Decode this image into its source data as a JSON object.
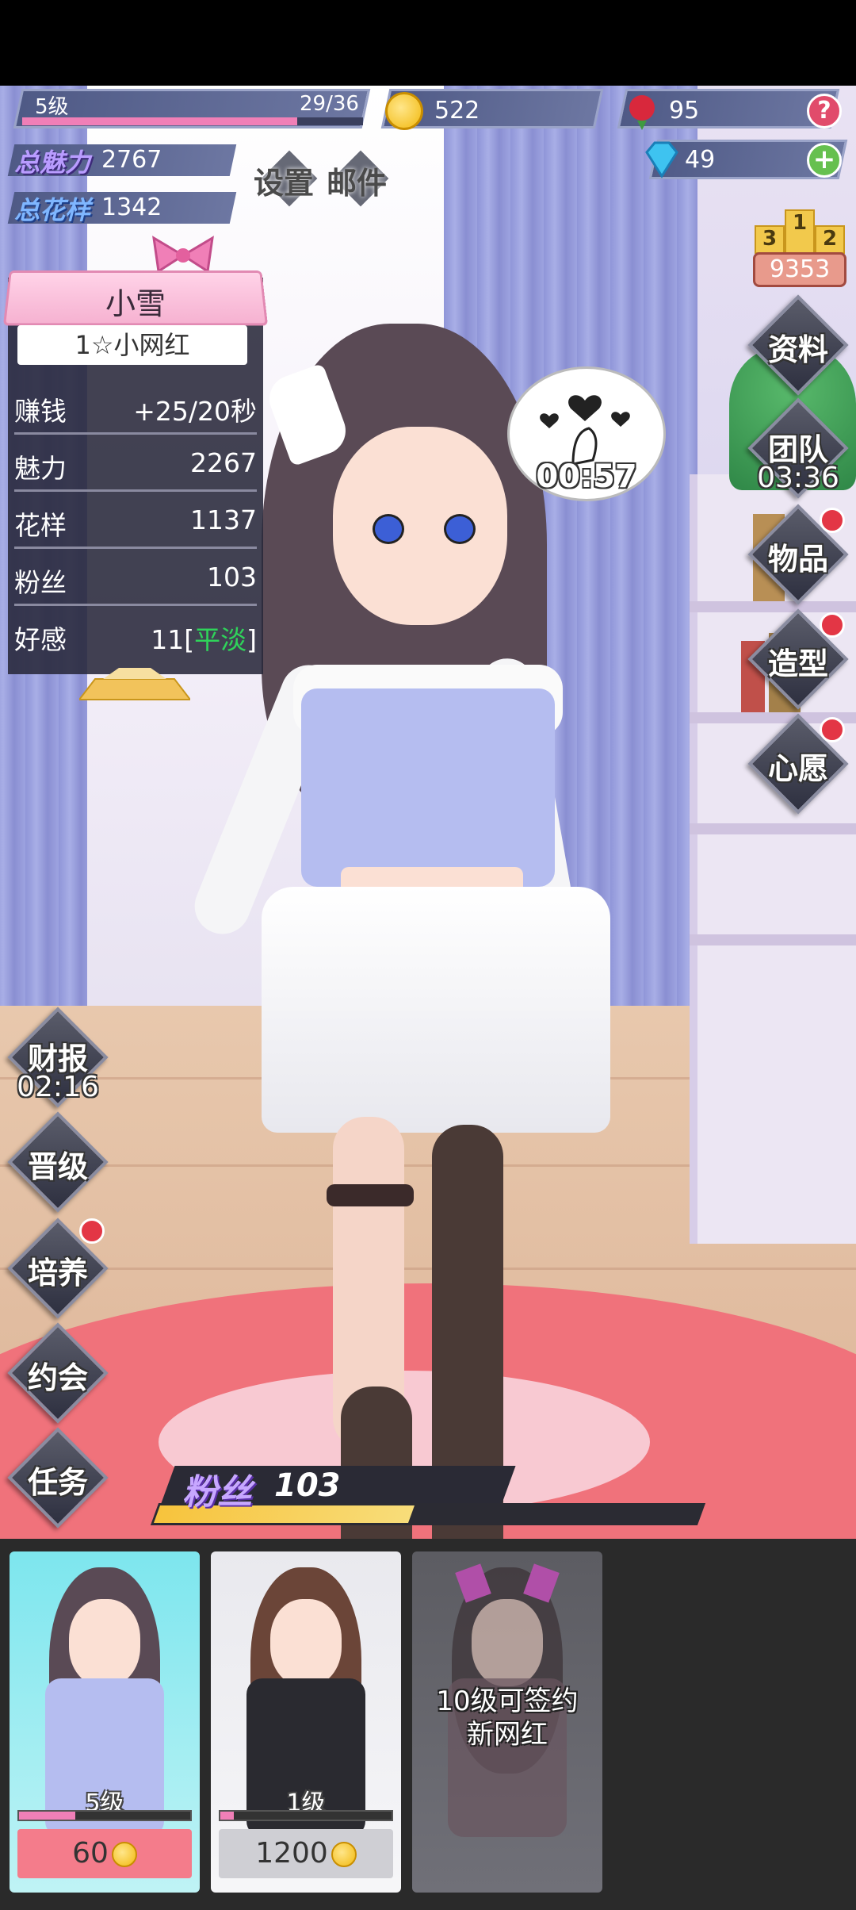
{
  "hud": {
    "level_label": "5级",
    "level_progress": "29/36",
    "level_progress_fraction": 0.806,
    "coins": "522",
    "roses": "95",
    "gems": "49",
    "help_label": "?",
    "add_label": "+",
    "total_charm_label": "总魅力",
    "total_charm_value": "2767",
    "total_style_label": "总花样",
    "total_style_value": "1342",
    "settings_label": "设置",
    "mail_label": "邮件",
    "rank_value": "9353",
    "podium": [
      "3",
      "1",
      "2"
    ]
  },
  "character": {
    "name": "小雪",
    "title": "1☆小网红",
    "stats": [
      {
        "key": "赚钱",
        "value": "+25/20秒"
      },
      {
        "key": "魅力",
        "value": "2267"
      },
      {
        "key": "花样",
        "value": "1137"
      },
      {
        "key": "粉丝",
        "value": "103"
      }
    ],
    "affection_key": "好感",
    "affection_value": "11",
    "affection_open": "[",
    "affection_state": "平淡",
    "affection_close": "]",
    "affection_color": "#2fd35a",
    "bubble_timer": "00:57"
  },
  "right_menu": [
    {
      "label": "资料",
      "sub": "",
      "dot": false
    },
    {
      "label": "团队",
      "sub": "03:36",
      "dot": false
    },
    {
      "label": "物品",
      "sub": "",
      "dot": true
    },
    {
      "label": "造型",
      "sub": "",
      "dot": true
    },
    {
      "label": "心愿",
      "sub": "",
      "dot": true
    }
  ],
  "left_menu": [
    {
      "label": "财报",
      "sub": "02:16",
      "dot": false
    },
    {
      "label": "晋级",
      "sub": "",
      "dot": false
    },
    {
      "label": "培养",
      "sub": "",
      "dot": true
    },
    {
      "label": "约会",
      "sub": "",
      "dot": false
    },
    {
      "label": "任务",
      "sub": "",
      "dot": false
    }
  ],
  "fans_bar": {
    "label": "粉丝",
    "value": "103",
    "progress_fraction": 0.47
  },
  "cards": [
    {
      "level": "5级",
      "price": "60",
      "progress_fraction": 0.33,
      "selected": true
    },
    {
      "level": "1级",
      "price": "1200",
      "progress_fraction": 0.08,
      "selected": false
    },
    {
      "locked_line1": "10级可签约",
      "locked_line2": "新网红",
      "locked": true
    }
  ],
  "colors": {
    "accent_pink": "#f07fb7",
    "hud_blue": "#5a6490",
    "notify_red": "#e33645",
    "fans_gold": "#f7c33c"
  }
}
